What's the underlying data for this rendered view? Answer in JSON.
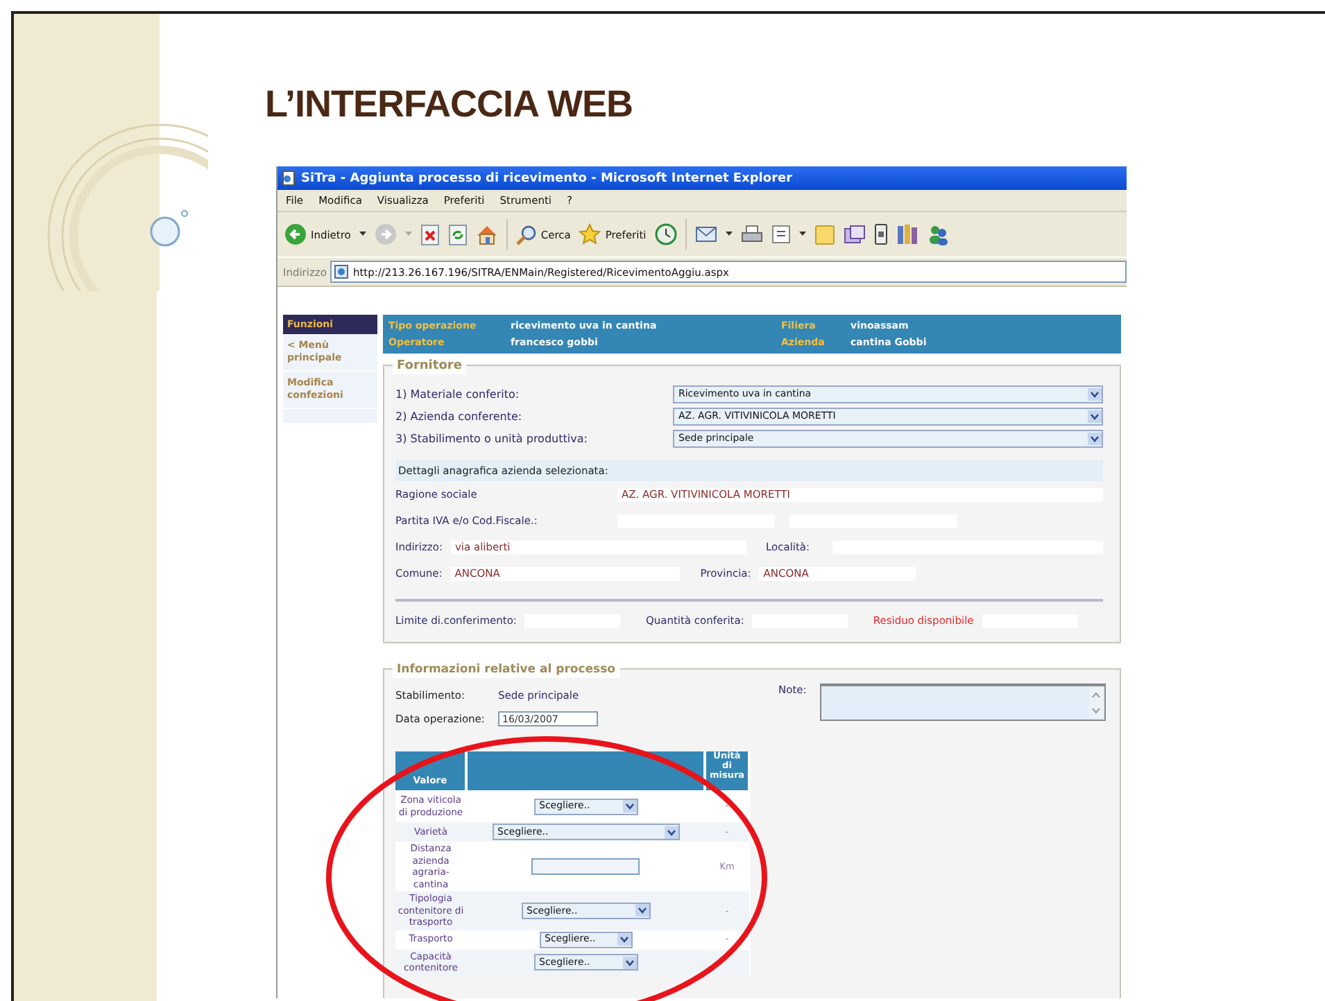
{
  "slide": {
    "title": "L’INTERFACCIA WEB"
  },
  "browser": {
    "title": "SiTra - Aggiunta processo di ricevimento - Microsoft Internet Explorer",
    "menu": [
      "File",
      "Modifica",
      "Visualizza",
      "Preferiti",
      "Strumenti",
      "?"
    ],
    "toolbar": {
      "back": "Indietro",
      "search": "Cerca",
      "favorites": "Preferiti"
    },
    "address": {
      "label": "Indirizzo",
      "url": "http://213.26.167.196/SITRA/ENMain/Registered/RicevimentoAggiu.aspx"
    }
  },
  "sidebar": {
    "title": "Funzioni",
    "items": [
      "< Menù principale",
      "Modifica confezioni"
    ]
  },
  "header": [
    {
      "label": "Tipo operazione",
      "value": "ricevimento uva in cantina"
    },
    {
      "label": "Filiera",
      "value": "vinoassam"
    },
    {
      "label": "Operatore",
      "value": "francesco gobbi"
    },
    {
      "label": "Azienda",
      "value": "cantina Gobbi"
    }
  ],
  "fornitore": {
    "legend": "Fornitore",
    "selects": [
      {
        "label": "1) Materiale conferito:",
        "value": "Ricevimento uva in cantina"
      },
      {
        "label": "2) Azienda conferente:",
        "value": "AZ. AGR. VITIVINICOLA MORETTI"
      },
      {
        "label": "3) Stabilimento o unità produttiva:",
        "value": "Sede principale"
      }
    ],
    "details_heading": "Dettagli anagrafica azienda selezionata:",
    "ragione_sociale": {
      "label": "Ragione sociale",
      "value": "AZ. AGR. VITIVINICOLA MORETTI"
    },
    "partita_iva": {
      "label": "Partita IVA e/o Cod.Fiscale.:"
    },
    "indirizzo": {
      "label": "Indirizzo:",
      "value": "via aliberti"
    },
    "localita": {
      "label": "Località:"
    },
    "comune": {
      "label": "Comune:",
      "value": "ANCONA"
    },
    "provincia": {
      "label": "Provincia:",
      "value": "ANCONA"
    },
    "limits": [
      {
        "label": "Limite di.conferimento:",
        "warning": false
      },
      {
        "label": "Quantità conferita:",
        "warning": false
      },
      {
        "label": "Residuo disponibile",
        "warning": true
      }
    ]
  },
  "processo": {
    "legend": "Informazioni relative al processo",
    "stabilimento": {
      "label": "Stabilimento:",
      "value": "Sede principale"
    },
    "data": {
      "label": "Data operazione:",
      "value": "16/03/2007"
    },
    "note": {
      "label": "Note:"
    },
    "table": {
      "value_header": "Valore",
      "unit_header": "Unità di misura",
      "rows": [
        {
          "label": "Zona viticola di produzione",
          "kind": "select",
          "value": "Scegliere..",
          "unit": "-"
        },
        {
          "label": "Varietà",
          "kind": "select",
          "value": "Scegliere..",
          "unit": "-"
        },
        {
          "label": "Distanza azienda agraria-cantina",
          "kind": "input",
          "unit": "Km"
        },
        {
          "label": "Tipologia contenitore di trasporto",
          "kind": "select",
          "value": "Scegliere..",
          "unit": "-"
        },
        {
          "label": "Trasporto",
          "kind": "select",
          "value": "Scegliere..",
          "unit": "-"
        },
        {
          "label": "Capacità contenitore",
          "kind": "select",
          "value": "Scegliere.."
        }
      ]
    }
  }
}
